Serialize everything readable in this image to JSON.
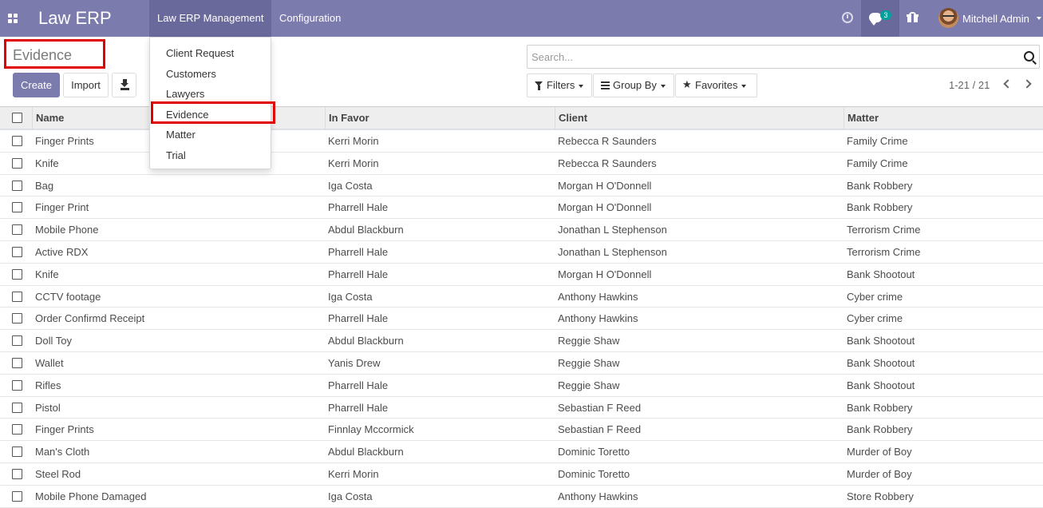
{
  "navbar": {
    "brand": "Law ERP",
    "menus": [
      "Law ERP Management",
      "Configuration"
    ],
    "chat_count": "3",
    "user_name": "Mitchell Admin",
    "accent_color": "#7c7bad"
  },
  "dropdown": {
    "items": [
      "Client Request",
      "Customers",
      "Lawyers",
      "Evidence",
      "Matter",
      "Trial"
    ],
    "highlighted": "Evidence"
  },
  "control_panel": {
    "title": "Evidence",
    "create_label": "Create",
    "import_label": "Import",
    "search_placeholder": "Search...",
    "filters_label": "Filters",
    "group_by_label": "Group By",
    "favorites_label": "Favorites",
    "pager": "1-21 / 21"
  },
  "table": {
    "columns": [
      "Name",
      "In Favor",
      "Client",
      "Matter"
    ],
    "rows": [
      [
        "Finger Prints",
        "Kerri Morin",
        "Rebecca R Saunders",
        "Family Crime"
      ],
      [
        "Knife",
        "Kerri Morin",
        "Rebecca R Saunders",
        "Family Crime"
      ],
      [
        "Bag",
        "Iga Costa",
        "Morgan H O'Donnell",
        "Bank Robbery"
      ],
      [
        "Finger Print",
        "Pharrell Hale",
        "Morgan H O'Donnell",
        "Bank Robbery"
      ],
      [
        "Mobile Phone",
        "Abdul Blackburn",
        "Jonathan L Stephenson",
        "Terrorism Crime"
      ],
      [
        "Active RDX",
        "Pharrell Hale",
        "Jonathan L Stephenson",
        "Terrorism Crime"
      ],
      [
        "Knife",
        "Pharrell Hale",
        "Morgan H O'Donnell",
        "Bank Shootout"
      ],
      [
        "CCTV footage",
        "Iga Costa",
        "Anthony Hawkins",
        "Cyber crime"
      ],
      [
        "Order Confirmd Receipt",
        "Pharrell Hale",
        "Anthony Hawkins",
        "Cyber crime"
      ],
      [
        "Doll Toy",
        "Abdul Blackburn",
        "Reggie Shaw",
        "Bank Shootout"
      ],
      [
        "Wallet",
        "Yanis Drew",
        "Reggie Shaw",
        "Bank Shootout"
      ],
      [
        "Rifles",
        "Pharrell Hale",
        "Reggie Shaw",
        "Bank Shootout"
      ],
      [
        "Pistol",
        "Pharrell Hale",
        "Sebastian F Reed",
        "Bank Robbery"
      ],
      [
        "Finger Prints",
        "Finnlay Mccormick",
        "Sebastian F Reed",
        "Bank Robbery"
      ],
      [
        "Man's Cloth",
        "Abdul Blackburn",
        "Dominic Toretto",
        "Murder of Boy"
      ],
      [
        "Steel Rod",
        "Kerri Morin",
        "Dominic Toretto",
        "Murder of Boy"
      ],
      [
        "Mobile Phone Damaged",
        "Iga Costa",
        "Anthony Hawkins",
        "Store Robbery"
      ]
    ]
  }
}
